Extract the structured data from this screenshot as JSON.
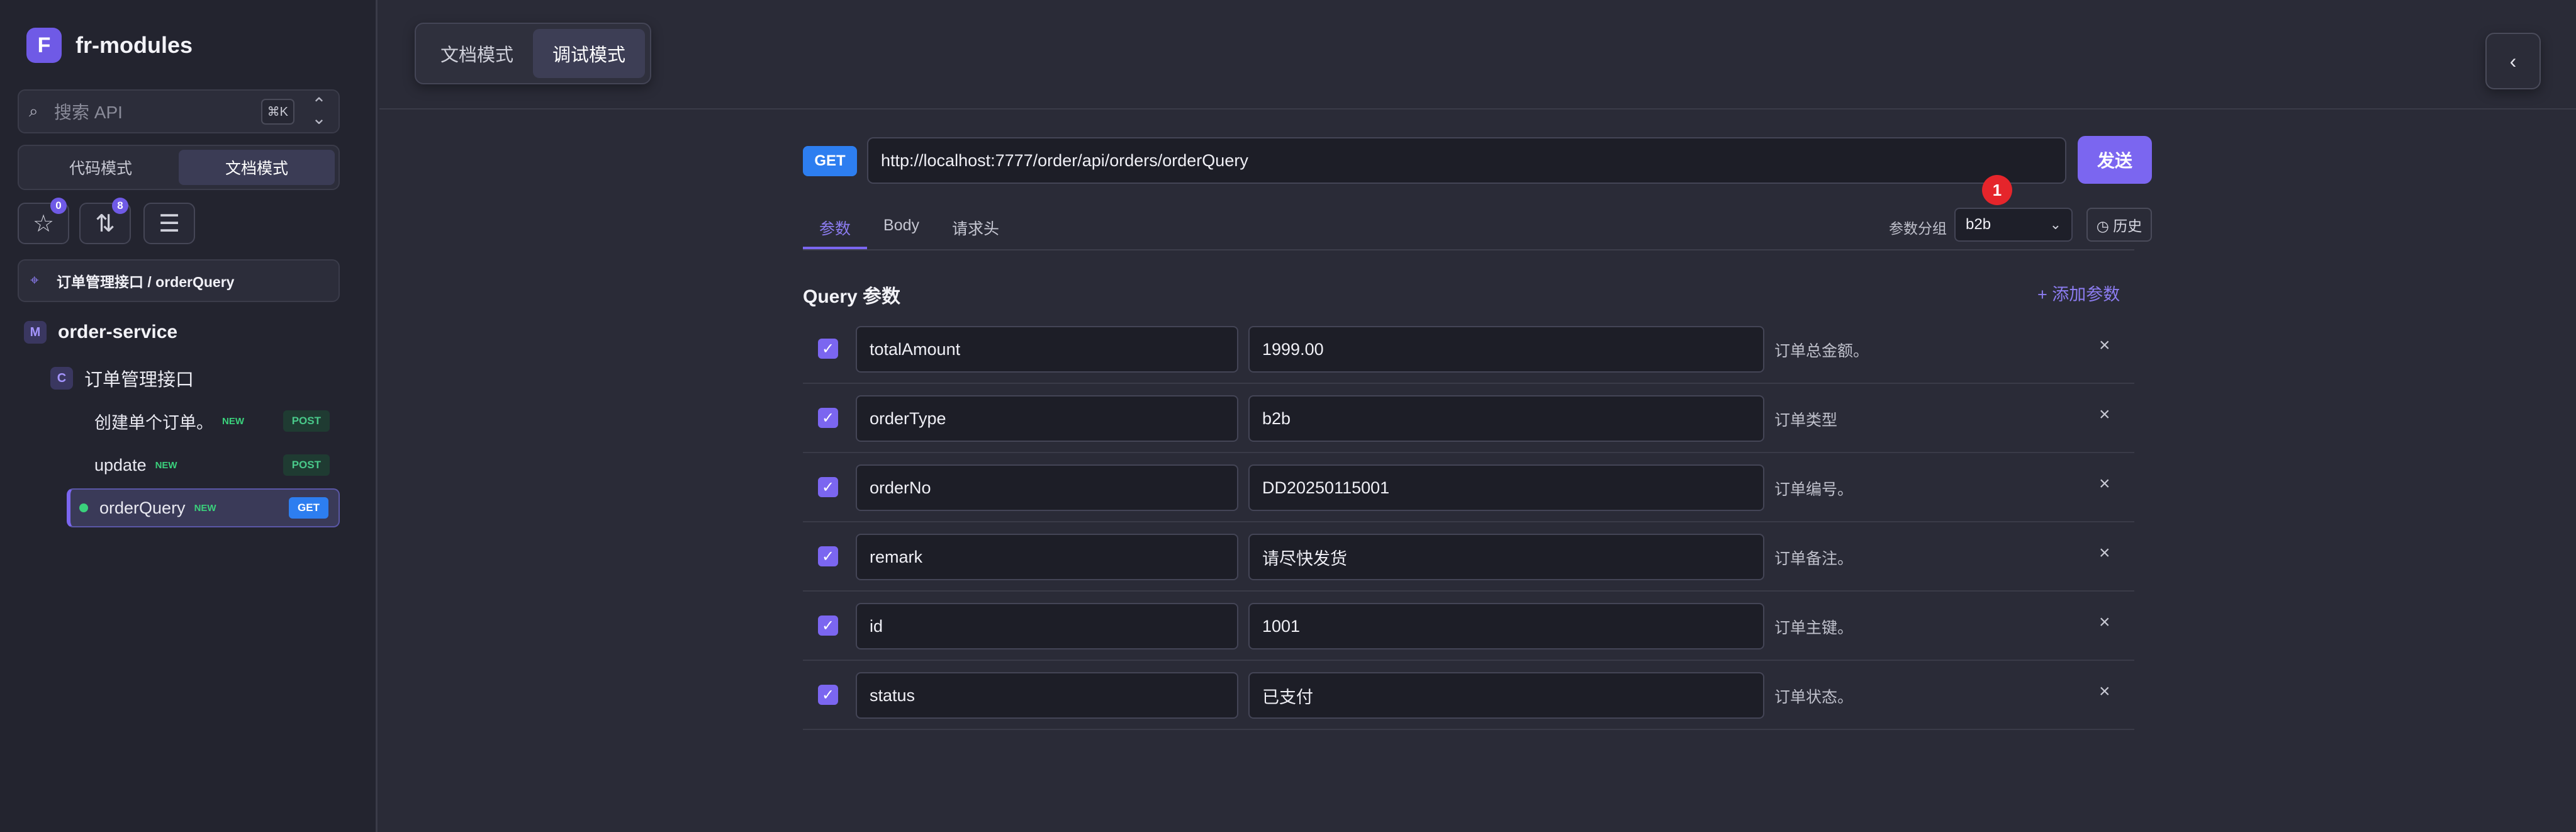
{
  "brand": {
    "logo_letter": "F",
    "name": "fr-modules"
  },
  "search": {
    "icon": "search-icon",
    "placeholder": "搜索 API",
    "shortcut": "⌘K"
  },
  "sidebar_mode": {
    "options": [
      "代码模式",
      "文档模式"
    ],
    "active": "文档模式"
  },
  "tools": {
    "favorites_badge": "0",
    "sort_badge": "8"
  },
  "breadcrumb": {
    "text": "订单管理接口 / orderQuery"
  },
  "tree": {
    "service": {
      "tag": "M",
      "name": "order-service"
    },
    "group": {
      "tag": "C",
      "name": "订单管理接口"
    },
    "apis": [
      {
        "name": "创建单个订单。",
        "new_label": "NEW",
        "method": "POST"
      },
      {
        "name": "update",
        "new_label": "NEW",
        "method": "POST"
      },
      {
        "name": "orderQuery",
        "new_label": "NEW",
        "method": "GET"
      }
    ]
  },
  "view_switch": {
    "options": [
      "文档模式",
      "调试模式"
    ],
    "active": "调试模式"
  },
  "back_button": {
    "label": "‹"
  },
  "request": {
    "method": "GET",
    "url": "http://localhost:7777/order/api/orders/orderQuery",
    "send_label": "发送",
    "notification_count": "1"
  },
  "tabs": [
    "参数",
    "Body",
    "请求头"
  ],
  "param_group": {
    "label": "参数分组",
    "value": "b2b"
  },
  "history_label": "◷ 历史",
  "query": {
    "title": "Query 参数",
    "add_label": "+ 添加参数",
    "params": [
      {
        "name": "totalAmount",
        "value": "1999.00",
        "desc": "订单总金额。"
      },
      {
        "name": "orderType",
        "value": "b2b",
        "desc": "订单类型"
      },
      {
        "name": "orderNo",
        "value": "DD20250115001",
        "desc": "订单编号。"
      },
      {
        "name": "remark",
        "value": "请尽快发货",
        "desc": "订单备注。"
      },
      {
        "name": "id",
        "value": "1001",
        "desc": "订单主键。"
      },
      {
        "name": "status",
        "value": "已支付",
        "desc": "订单状态。"
      }
    ]
  },
  "colors": {
    "accent": "#7b66f0",
    "get": "#2d7ef0",
    "post": "#49c98a",
    "alert": "#e5252b"
  }
}
